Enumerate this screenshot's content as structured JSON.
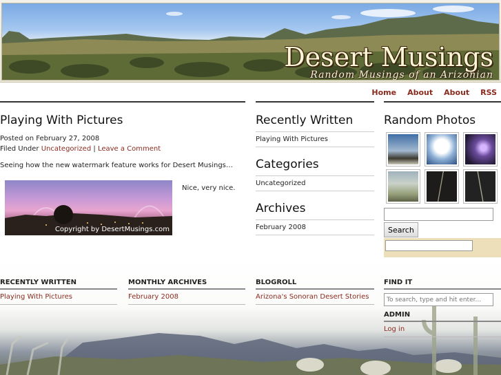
{
  "header": {
    "title": "Desert Musings",
    "tagline": "Random Musings of an Arizonian"
  },
  "nav": [
    "Home",
    "About",
    "About",
    "RSS"
  ],
  "post": {
    "title": "Playing With Pictures",
    "posted_prefix": "Posted on",
    "date": "February 27, 2008",
    "filed_prefix": "Filed Under",
    "category": "Uncategorized",
    "separator": "|",
    "comment_link": "Leave a Comment",
    "body": "Seeing how the new watermark feature works for Desert Musings…",
    "photo_watermark": "Copyright by DesertMusings.com",
    "photo_caption": "Nice, very nice."
  },
  "sidebar_mid": {
    "recent_title": "Recently Written",
    "recent_items": [
      "Playing With Pictures"
    ],
    "categories_title": "Categories",
    "categories_items": [
      "Uncategorized"
    ],
    "archives_title": "Archives",
    "archives_items": [
      "February 2008"
    ]
  },
  "sidebar_right": {
    "photos_title": "Random Photos",
    "search_button": "Search"
  },
  "footer": {
    "recent_title": "RECENTLY WRITTEN",
    "recent_link": "Playing With Pictures",
    "archives_title": "MONTHLY ARCHIVES",
    "archives_link": "February 2008",
    "blogroll_title": "BLOGROLL",
    "blogroll_link": "Arizona's Sonoran Desert Stories",
    "findit_title": "FIND IT",
    "findit_placeholder": "To search, type and hit enter...",
    "admin_title": "ADMIN",
    "admin_link": "Log in"
  }
}
